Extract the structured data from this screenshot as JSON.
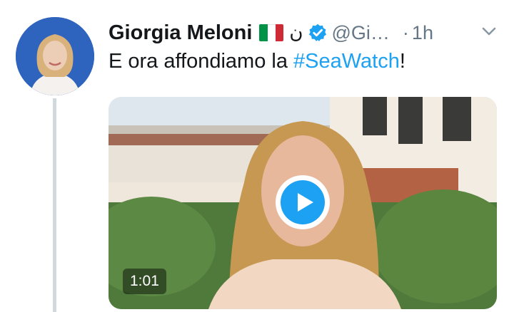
{
  "tweet": {
    "author_name": "Giorgia Meloni",
    "author_symbol": "ن",
    "handle": "@Gi…",
    "separator": "·",
    "time": "1h",
    "text_before": "E ora affondiamo la ",
    "hashtag": "#SeaWatch",
    "text_after": "!"
  },
  "media": {
    "duration": "1:01"
  },
  "icons": {
    "flag": "italy-flag-icon",
    "verified": "verified-badge-icon",
    "menu": "chevron-down-icon",
    "play": "play-icon"
  },
  "colors": {
    "accent": "#1da1f2",
    "text": "#14171a",
    "secondary": "#657786",
    "thread_line": "#cfd9de",
    "flag_green": "#009246",
    "flag_white": "#ffffff",
    "flag_red": "#ce2b37"
  }
}
